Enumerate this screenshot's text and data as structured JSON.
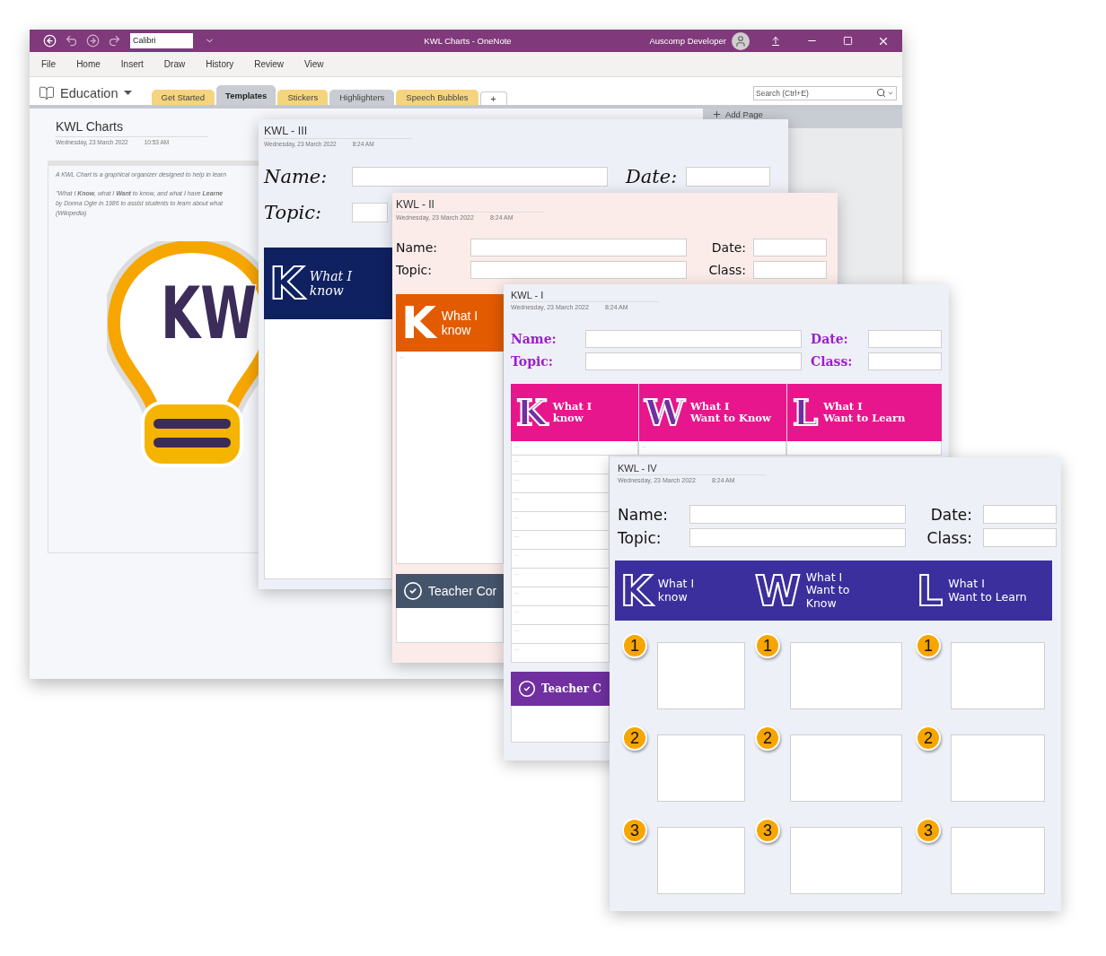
{
  "window": {
    "title": "KWL Charts - OneNote",
    "font_name": "Calibri",
    "user": "Auscomp Developer"
  },
  "menu": [
    "File",
    "Home",
    "Insert",
    "Draw",
    "History",
    "Review",
    "View"
  ],
  "notebook": {
    "name": "Education"
  },
  "section_tabs": [
    {
      "label": "Get Started",
      "color": "#f5d47e",
      "selected": false
    },
    {
      "label": "Templates",
      "color": "#c9ccd3",
      "selected": true
    },
    {
      "label": "Stickers",
      "color": "#f5d47e",
      "selected": false
    },
    {
      "label": "Highlighters",
      "color": "#c9ccd3",
      "selected": false
    },
    {
      "label": "Speech Bubbles",
      "color": "#f5d47e",
      "selected": false
    }
  ],
  "add_section": "+",
  "search": {
    "placeholder": "Search (Ctrl+E)"
  },
  "page_list": {
    "add_page": "Add Page"
  },
  "page": {
    "title": "KWL Charts",
    "date": "Wednesday, 23 March 2022",
    "time": "10:53 AM",
    "note_lines": [
      "A KWL Chart is a graphical organizer designed to help in learn",
      "\"What I **Know**, what I **Want** to know, and what I have **Learne**",
      "by Donna Ogle in 1986 to assist students to learn about what",
      "(Wikipedia)"
    ],
    "logo_text": "KW"
  },
  "kwl_iii": {
    "title": "KWL - III",
    "date": "Wednesday, 23 March 2022",
    "time": "8:24 AM",
    "labels": [
      "Name:",
      "Date:",
      "Topic:"
    ],
    "columns": [
      {
        "letter": "K",
        "heading": "What I\nknow"
      }
    ]
  },
  "kwl_ii": {
    "title": "KWL - II",
    "date": "Wednesday, 23 March 2022",
    "time": "8:24 AM",
    "labels": [
      "Name:",
      "Date:",
      "Topic:",
      "Class:"
    ],
    "columns": [
      {
        "letter": "K",
        "heading": "What I\nknow",
        "rows": [
          "..."
        ]
      }
    ],
    "comments_heading": "Teacher Cor"
  },
  "kwl_i": {
    "title": "KWL - I",
    "date": "Wednesday, 23 March 2022",
    "time": "8:24 AM",
    "labels": [
      "Name:",
      "Date:",
      "Topic:",
      "Class:"
    ],
    "columns": [
      {
        "letter": "K",
        "heading": "What I\nknow",
        "rows": [
          "...",
          "...",
          "...",
          "...",
          "...",
          "...",
          "...",
          "...",
          "...",
          "...",
          "...",
          "..."
        ]
      },
      {
        "letter": "W",
        "heading": "What I\nWant to Know",
        "rows": [
          "..."
        ]
      },
      {
        "letter": "L",
        "heading": "What I\nWant to Learn"
      }
    ],
    "comments_heading": "Teacher C"
  },
  "kwl_iv": {
    "title": "KWL - IV",
    "date": "Wednesday, 23 March 2022",
    "time": "8:24 AM",
    "labels": [
      "Name:",
      "Date:",
      "Topic:",
      "Class:"
    ],
    "columns": [
      {
        "letter": "K",
        "heading": "What I\nknow",
        "items": [
          "1",
          "2",
          "3"
        ]
      },
      {
        "letter": "W",
        "heading": "What I\nWant to\nKnow",
        "items": [
          "1",
          "2",
          "3"
        ]
      },
      {
        "letter": "L",
        "heading": "What I\nWant to Learn",
        "items": [
          "1",
          "2",
          "3"
        ]
      }
    ]
  }
}
